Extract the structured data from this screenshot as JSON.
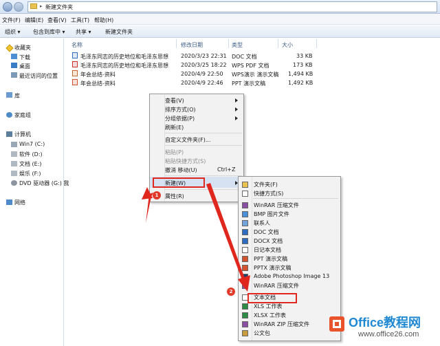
{
  "address": {
    "path": "新建文件夹",
    "separator": "▸"
  },
  "menu": [
    "文件(F)",
    "编辑(E)",
    "查看(V)",
    "工具(T)",
    "帮助(H)"
  ],
  "toolbar": [
    "组织 ▾",
    "包含到库中 ▾",
    "共享 ▾",
    "新建文件夹"
  ],
  "columns": {
    "name": "名称",
    "modified": "修改日期",
    "type": "类型",
    "size": "大小"
  },
  "files": [
    {
      "name": "毛泽东同志的历史地位和毛泽东思想",
      "modified": "2020/3/23 22:31",
      "type": "DOC 文档",
      "size": "33 KB",
      "icon": "doc-icon"
    },
    {
      "name": "毛泽东同志的历史地位和毛泽东思想",
      "modified": "2020/3/25 18:22",
      "type": "WPS PDF 文档",
      "size": "173 KB",
      "icon": "pdf-icon"
    },
    {
      "name": "年会总结-资料",
      "modified": "2020/4/9 22:50",
      "type": "WPS演示 演示文稿",
      "size": "1,494 KB",
      "icon": "wps-ppt-icon"
    },
    {
      "name": "年会总结-资料",
      "modified": "2020/4/9 22:46",
      "type": "PPT 演示文稿",
      "size": "1,492 KB",
      "icon": "ppt-icon"
    }
  ],
  "nav": {
    "favorites": "收藏夹",
    "downloads": "下载",
    "desktop": "桌面",
    "recent": "最近访问的位置",
    "library": "库",
    "homegroup": "家庭组",
    "computer": "计算机",
    "drives": [
      "Win7 (C:)",
      "软件 (D:)",
      "文档 (E:)",
      "娱乐 (F:)",
      "DVD 驱动器 (G:) 我"
    ],
    "network": "网络"
  },
  "context_menu": {
    "view": "查看(V)",
    "sort": "排序方式(O)",
    "group": "分组依据(P)",
    "refresh": "刷新(E)",
    "customize": "自定义文件夹(F)...",
    "paste": "粘贴(P)",
    "paste_shortcut": "粘贴快捷方式(S)",
    "undo": "撤消 移动(U)",
    "undo_shortcut": "Ctrl+Z",
    "new": "新建(W)",
    "properties": "属性(R)"
  },
  "submenu": [
    {
      "label": "文件夹(F)",
      "icon": "folder-icon",
      "color": "#e8c352"
    },
    {
      "label": "快捷方式(S)",
      "icon": "shortcut-icon",
      "color": "#ffffff"
    },
    {
      "label": "WinRAR 压缩文件",
      "icon": "winrar-icon",
      "color": "#8a4fa3"
    },
    {
      "label": "BMP 图片文件",
      "icon": "bmp-icon",
      "color": "#4a90d9"
    },
    {
      "label": "联系人",
      "icon": "contact-icon",
      "color": "#6fa3d9"
    },
    {
      "label": "DOC 文档",
      "icon": "doc-icon",
      "color": "#2d6cc0"
    },
    {
      "label": "DOCX 文档",
      "icon": "docx-icon",
      "color": "#2d6cc0"
    },
    {
      "label": "日记本文档",
      "icon": "journal-icon",
      "color": "#ffffff"
    },
    {
      "label": "PPT 演示文稿",
      "icon": "ppt-icon",
      "color": "#d2542e"
    },
    {
      "label": "PPTX 演示文稿",
      "icon": "pptx-icon",
      "color": "#d2542e"
    },
    {
      "label": "Adobe Photoshop Image 13",
      "icon": "photoshop-icon",
      "color": "#1c3f6b"
    },
    {
      "label": "WinRAR 压缩文件",
      "icon": "winrar-icon",
      "color": "#8a4fa3"
    },
    {
      "label": "文本文档",
      "icon": "text-doc-icon",
      "color": "#ffffff"
    },
    {
      "label": "XLS 工作表",
      "icon": "xls-icon",
      "color": "#2e8b47"
    },
    {
      "label": "XLSX 工作表",
      "icon": "xlsx-icon",
      "color": "#2e8b47"
    },
    {
      "label": "WinRAR ZIP 压缩文件",
      "icon": "winrar-zip-icon",
      "color": "#8a4fa3"
    },
    {
      "label": "公文包",
      "icon": "briefcase-icon",
      "color": "#c89b3c"
    }
  ],
  "badges": [
    "1",
    "2"
  ],
  "watermark": {
    "brand": "Office教程网",
    "url": "www.office26.com"
  },
  "colors": {
    "highlight": "#e0271d",
    "accent": "#1e88d2"
  }
}
